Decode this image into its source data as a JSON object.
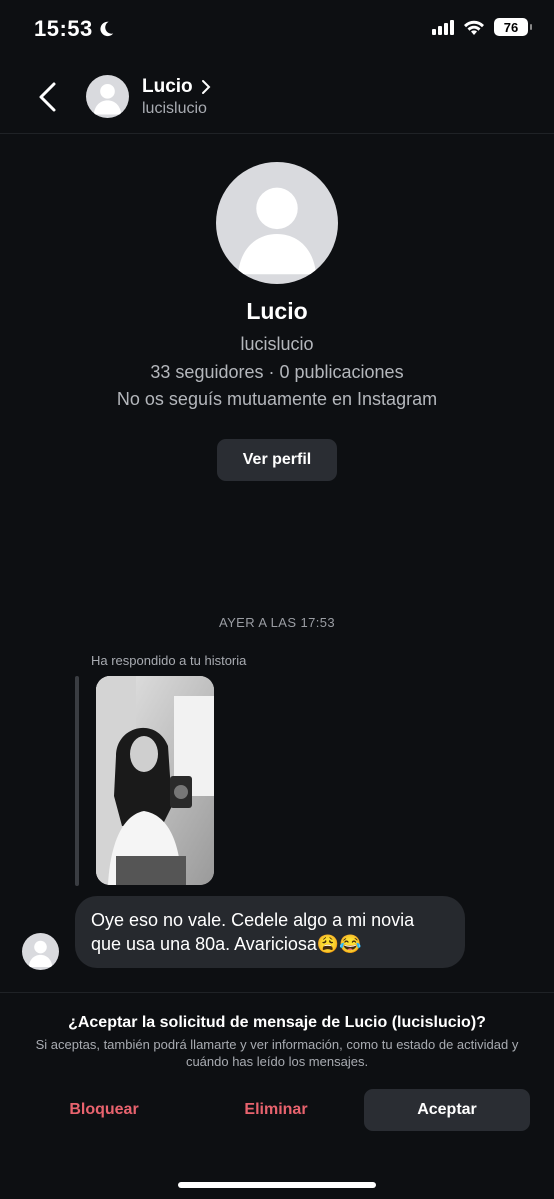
{
  "status_bar": {
    "time": "15:53",
    "battery": "76"
  },
  "header": {
    "name": "Lucio",
    "username": "lucislucio"
  },
  "profile": {
    "name": "Lucio",
    "username": "lucislucio",
    "stats": "33 seguidores · 0 publicaciones",
    "mutual": "No os seguís mutuamente en Instagram",
    "view_profile_label": "Ver perfil"
  },
  "thread": {
    "timestamp": "AYER A LAS 17:53",
    "story_reply_label": "Ha respondido a tu historia",
    "message": "Oye eso no vale. Cedele algo a mi novia que usa una 80a. Avariciosa😩😂"
  },
  "request": {
    "title": "¿Aceptar la solicitud de mensaje de Lucio (lucislucio)?",
    "description": "Si aceptas, también podrá llamarte y ver información, como tu estado de actividad y cuándo has leído los mensajes.",
    "block_label": "Bloquear",
    "delete_label": "Eliminar",
    "accept_label": "Aceptar"
  },
  "colors": {
    "background": "#0d0f12",
    "danger": "#e8636e",
    "button_bg": "#2a2d33"
  }
}
